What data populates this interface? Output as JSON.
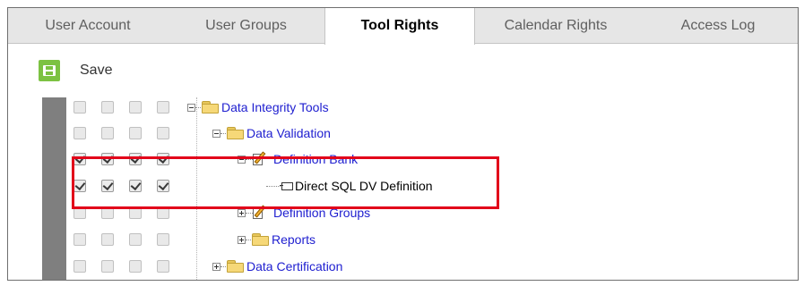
{
  "tabs": [
    {
      "label": "User Account"
    },
    {
      "label": "User Groups"
    },
    {
      "label": "Tool Rights"
    },
    {
      "label": "Calendar Rights"
    },
    {
      "label": "Access Log"
    }
  ],
  "active_tab": "Tool Rights",
  "toolbar": {
    "save_label": "Save"
  },
  "tree": [
    {
      "label": "Data Integrity Tools",
      "checked": [
        false,
        false,
        false,
        false
      ],
      "expander": "minus",
      "icon": "folder-icon"
    },
    {
      "label": "Data Validation",
      "checked": [
        false,
        false,
        false,
        false
      ],
      "expander": "minus",
      "icon": "folder-icon"
    },
    {
      "label": "Definition Bank",
      "checked": [
        true,
        true,
        true,
        true
      ],
      "expander": "minus",
      "icon": "edit-document-icon"
    },
    {
      "label": "Direct SQL DV Definition",
      "checked": [
        true,
        true,
        true,
        true
      ],
      "expander": "none",
      "icon": "leaf-item-icon"
    },
    {
      "label": "Definition Groups",
      "checked": [
        false,
        false,
        false,
        false
      ],
      "expander": "plus",
      "icon": "edit-document-icon"
    },
    {
      "label": "Reports",
      "checked": [
        false,
        false,
        false,
        false
      ],
      "expander": "plus",
      "icon": "folder-icon"
    },
    {
      "label": "Data Certification",
      "checked": [
        false,
        false,
        false,
        false
      ],
      "expander": "plus",
      "icon": "folder-icon"
    }
  ],
  "colors": {
    "save_green": "#7cc242",
    "link_blue": "#2020d0",
    "highlight_red": "#e2001a"
  }
}
